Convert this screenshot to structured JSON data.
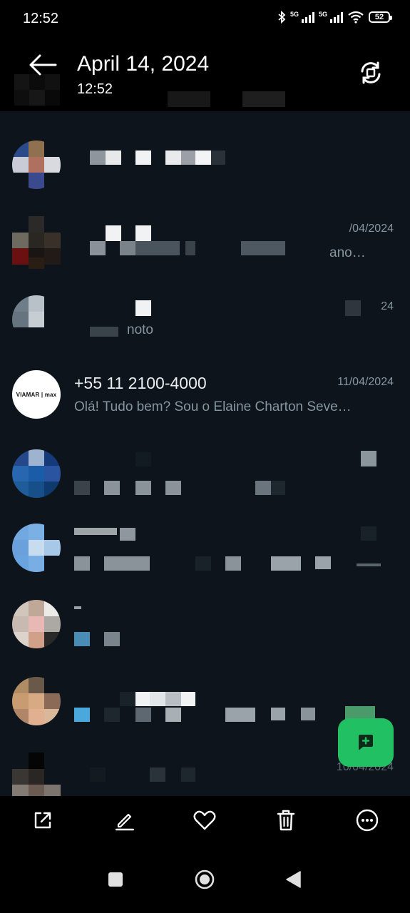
{
  "status_bar": {
    "time": "12:52",
    "network_1": "5G",
    "network_2": "5G",
    "battery": "52"
  },
  "header": {
    "title": "April 14, 2024",
    "subtitle": "12:52"
  },
  "chats": [
    {
      "date": "",
      "preview": ""
    },
    {
      "date": "/04/2024",
      "preview": "ano…"
    },
    {
      "date": "24",
      "preview": "noto"
    },
    {
      "name": "+55 11 2100-4000",
      "date": "11/04/2024",
      "preview": "Olá! Tudo bem? Sou o Elaine Charton Seve…",
      "avatar_text": "VIAMAR | max"
    },
    {
      "date": "",
      "preview": ""
    },
    {
      "date": "",
      "preview": ""
    },
    {
      "date": "",
      "preview": ""
    },
    {
      "date": "",
      "preview": ""
    },
    {
      "date": "10/04/2024",
      "preview": ""
    }
  ],
  "icons": {
    "back": "arrow-left-icon",
    "rotate": "rotate-icon",
    "fab": "new-chat-icon",
    "share": "share-icon",
    "edit": "edit-icon",
    "favorite": "heart-icon",
    "delete": "trash-icon",
    "more": "more-icon"
  },
  "colors": {
    "background": "#0d141b",
    "accent": "#21c063",
    "secondary_text": "#8696a0"
  }
}
